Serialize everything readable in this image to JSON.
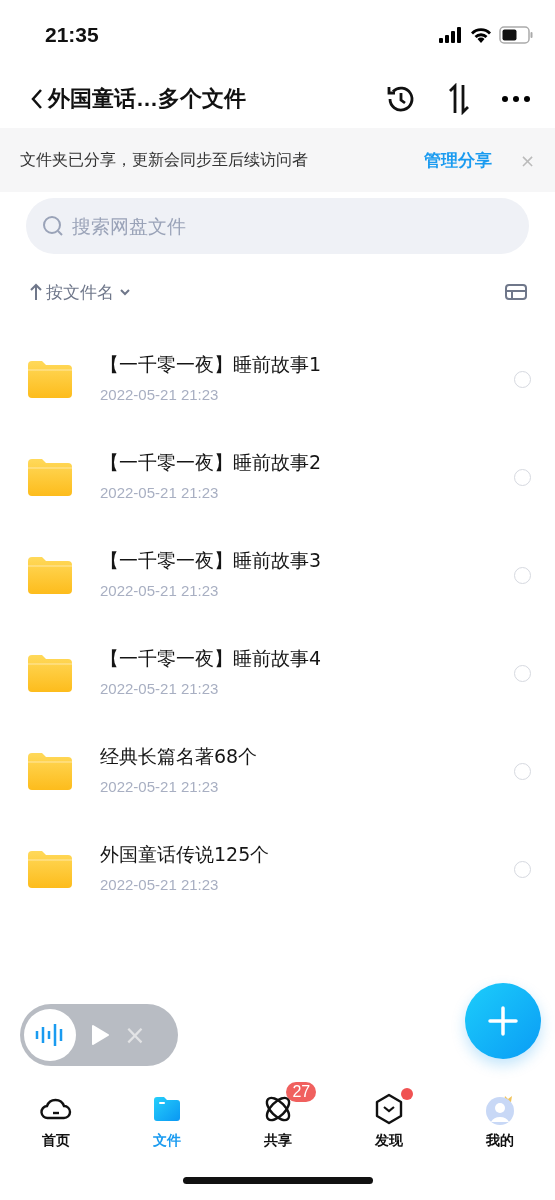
{
  "status_bar": {
    "time": "21:35"
  },
  "header": {
    "title": "外国童话…多个文件"
  },
  "banner": {
    "text": "文件夹已分享，更新会同步至后续访问者",
    "action": "管理分享",
    "close": "×"
  },
  "search": {
    "placeholder": "搜索网盘文件"
  },
  "sort": {
    "label": "按文件名"
  },
  "files": [
    {
      "name": "【一千零一夜】睡前故事1",
      "date": "2022-05-21 21:23",
      "selected": false
    },
    {
      "name": "【一千零一夜】睡前故事2",
      "date": "2022-05-21 21:23",
      "selected": false
    },
    {
      "name": "【一千零一夜】睡前故事3",
      "date": "2022-05-21 21:23",
      "selected": false
    },
    {
      "name": "【一千零一夜】睡前故事4",
      "date": "2022-05-21 21:23",
      "selected": false
    },
    {
      "name": "经典长篇名著68个",
      "date": "2022-05-21 21:23",
      "selected": false
    },
    {
      "name": "外国童话传说125个",
      "date": "2022-05-21 21:23",
      "selected": false
    }
  ],
  "player": {
    "close": "×"
  },
  "tabs": [
    {
      "kind": "home",
      "label": "首页",
      "selected": false,
      "dot": false
    },
    {
      "kind": "files",
      "label": "文件",
      "selected": true,
      "dot": false
    },
    {
      "kind": "share",
      "label": "共享",
      "selected": false,
      "dot": false,
      "badge": "27"
    },
    {
      "kind": "discover",
      "label": "发现",
      "selected": false,
      "dot": true
    },
    {
      "kind": "me",
      "label": "我的",
      "selected": false,
      "dot": false
    }
  ]
}
